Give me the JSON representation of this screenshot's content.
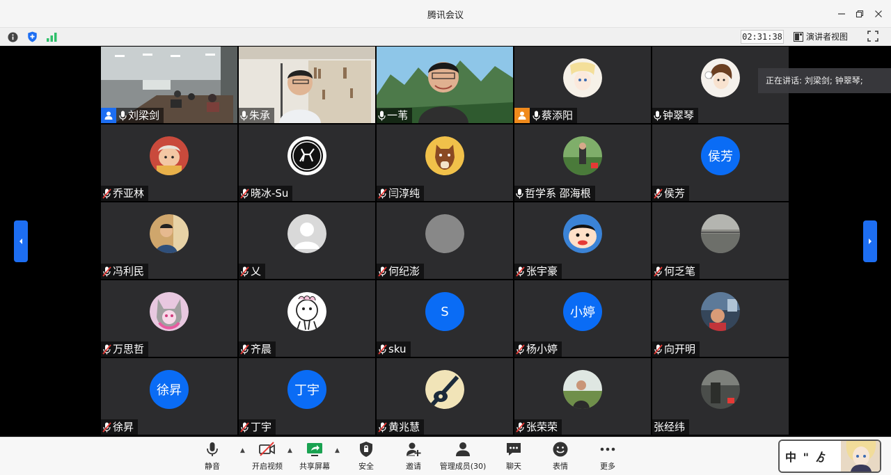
{
  "window": {
    "title": "腾讯会议",
    "controls": [
      "minimize",
      "restore",
      "close"
    ]
  },
  "infobar": {
    "timer": "02:31:38",
    "presenter_view_label": "演讲者视图"
  },
  "speaking_banner": "正在讲话: 刘梁剑; 钟翠琴;",
  "participants": [
    {
      "name": "刘梁剑",
      "mic": "on",
      "host": true,
      "type": "video"
    },
    {
      "name": "朱承",
      "mic": "on",
      "type": "video"
    },
    {
      "name": "一苇",
      "mic": "on",
      "type": "video"
    },
    {
      "name": "蔡添阳",
      "mic": "on",
      "cohost": true,
      "type": "avatar"
    },
    {
      "name": "钟翠琴",
      "mic": "on",
      "type": "avatar"
    },
    {
      "name": "乔亚林",
      "mic": "muted",
      "type": "avatar"
    },
    {
      "name": "晓冰-Su",
      "mic": "muted",
      "type": "avatar"
    },
    {
      "name": "闫淳纯",
      "mic": "muted",
      "type": "avatar"
    },
    {
      "name": "哲学系 邵海根",
      "mic": "on",
      "type": "avatar"
    },
    {
      "name": "侯芳",
      "mic": "muted",
      "type": "initials",
      "initials": "侯芳"
    },
    {
      "name": "冯利民",
      "mic": "muted",
      "type": "avatar"
    },
    {
      "name": "乂",
      "mic": "muted",
      "type": "avatar"
    },
    {
      "name": "何纪澎",
      "mic": "muted",
      "type": "avatar"
    },
    {
      "name": "张宇豪",
      "mic": "muted",
      "type": "avatar"
    },
    {
      "name": "何乏笔",
      "mic": "muted",
      "type": "avatar"
    },
    {
      "name": "万思哲",
      "mic": "muted",
      "type": "avatar"
    },
    {
      "name": "齐晨",
      "mic": "muted",
      "type": "avatar"
    },
    {
      "name": "sku",
      "mic": "muted",
      "type": "initials",
      "initials": "S"
    },
    {
      "name": "杨小婷",
      "mic": "muted",
      "type": "initials",
      "initials": "小婷"
    },
    {
      "name": "向开明",
      "mic": "muted",
      "type": "avatar"
    },
    {
      "name": "徐昇",
      "mic": "muted",
      "type": "initials",
      "initials": "徐昇"
    },
    {
      "name": "丁宇",
      "mic": "muted",
      "type": "initials",
      "initials": "丁宇"
    },
    {
      "name": "黄兆慧",
      "mic": "muted",
      "type": "avatar"
    },
    {
      "name": "张荣荣",
      "mic": "muted",
      "type": "avatar"
    },
    {
      "name": "张经纬",
      "mic": "none",
      "type": "avatar"
    }
  ],
  "toolbar": {
    "mute": "静音",
    "video": "开启视频",
    "share": "共享屏幕",
    "security": "安全",
    "invite": "邀请",
    "members": "管理成员(30)",
    "chat": "聊天",
    "reactions": "表情",
    "more": "更多"
  },
  "selfview_text": "中 \" ゟ",
  "colors": {
    "accent": "#1d6ef2",
    "initials_bg": "#0a6cf5",
    "tile_bg": "#2c2c2e",
    "active_outline": "#2fbf6a",
    "muted_red": "#e53935"
  }
}
